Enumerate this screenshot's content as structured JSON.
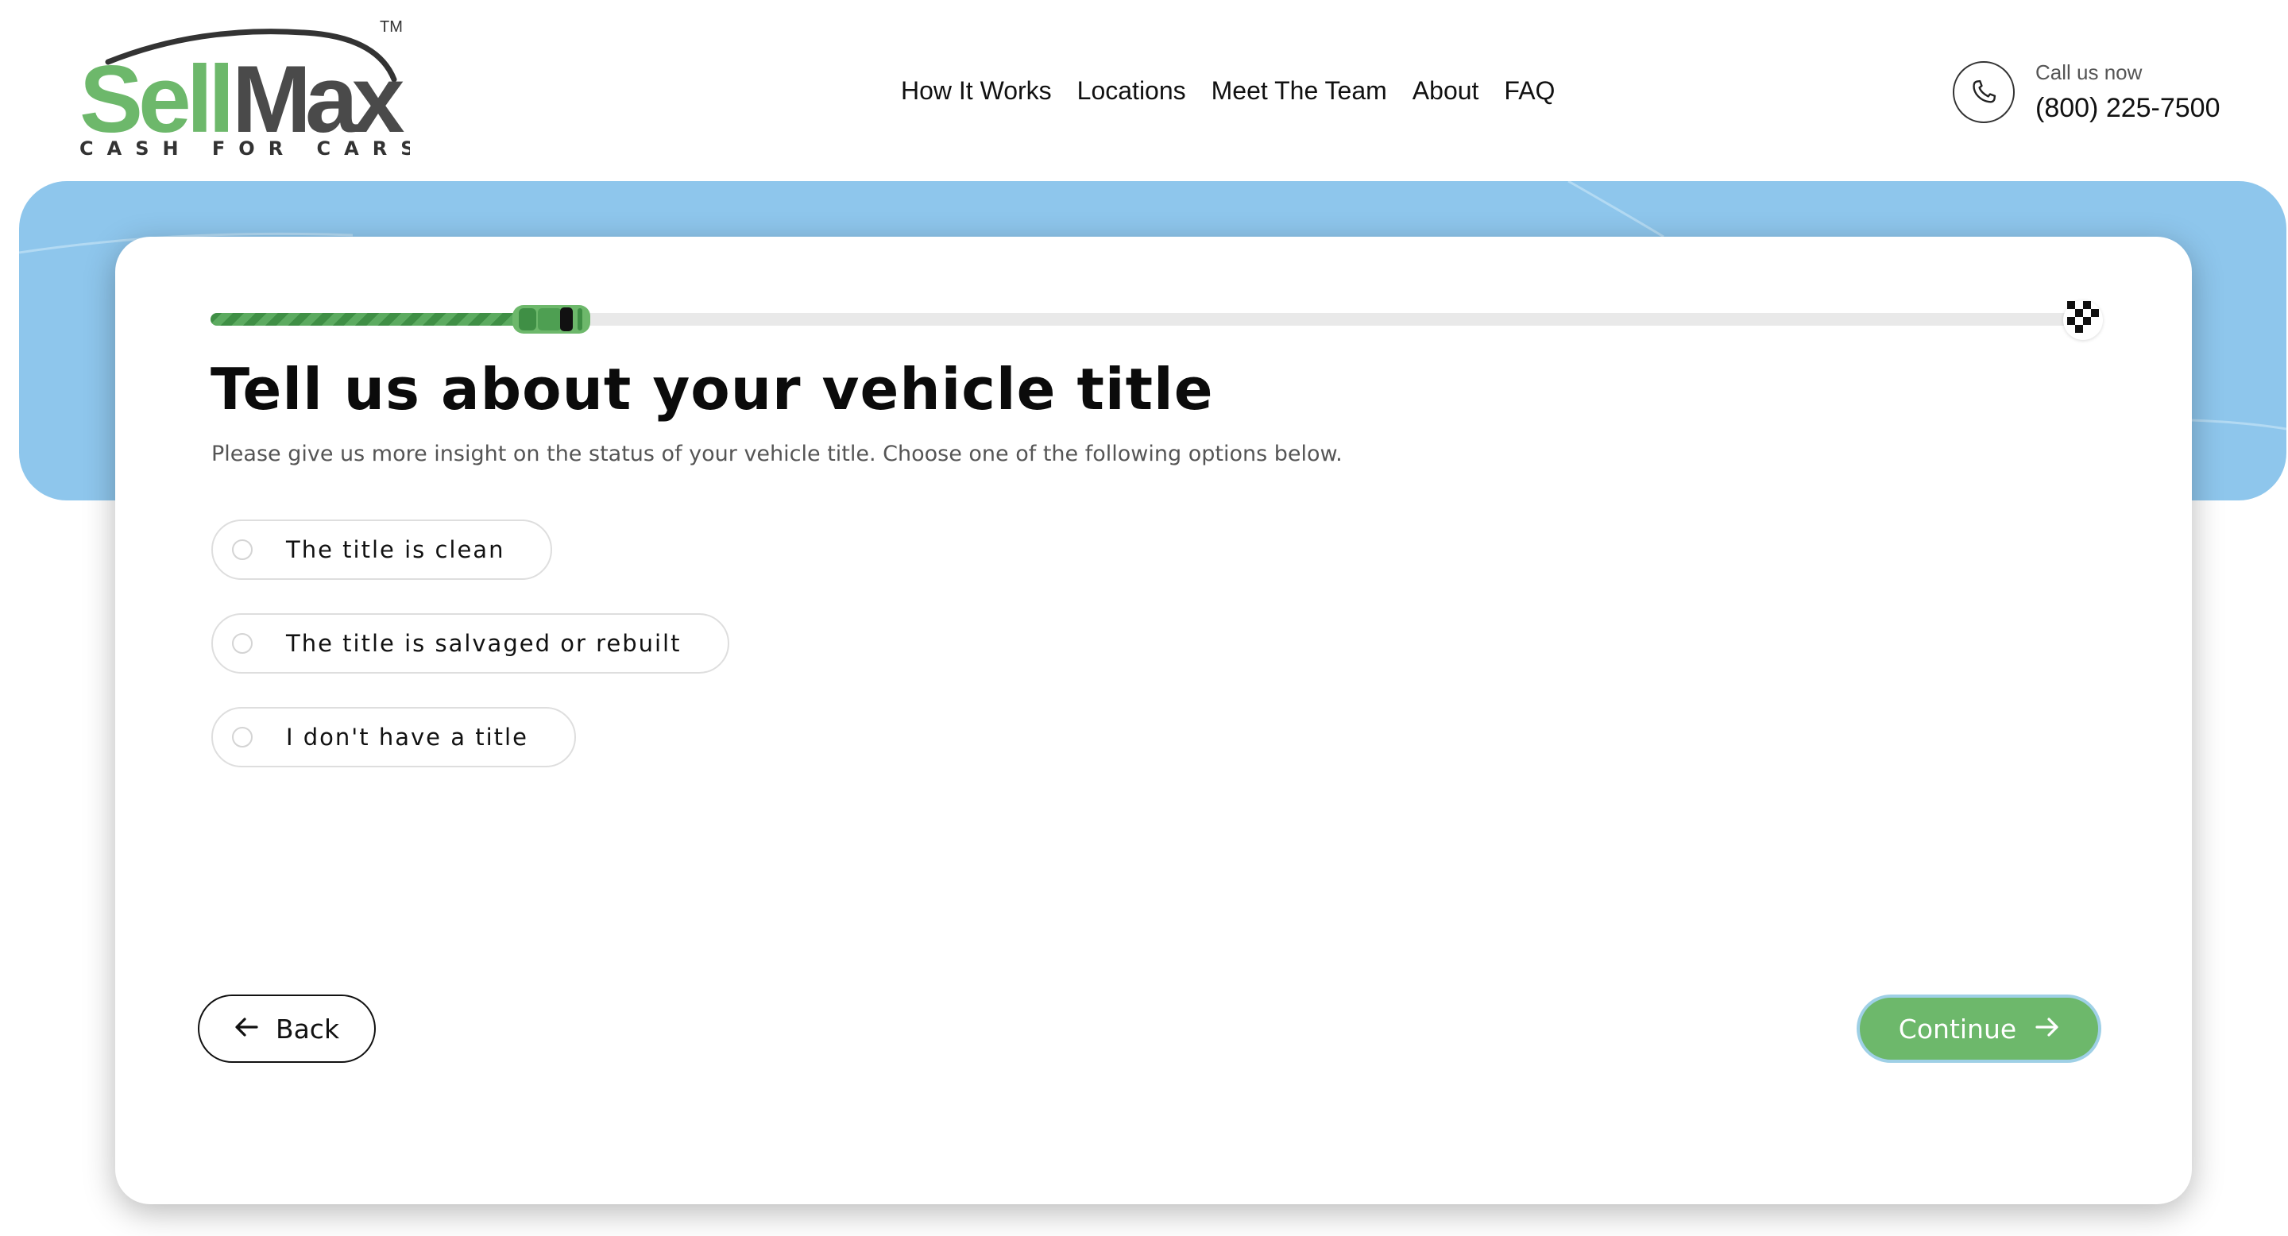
{
  "brand": {
    "logo_word_part1": "Sell",
    "logo_word_part2": "Max",
    "logo_tagline": "CASH FOR CARS",
    "trademark": "TM",
    "green": "#6db86b",
    "dark_gray": "#4a4a4a"
  },
  "nav": {
    "items": [
      "How It Works",
      "Locations",
      "Meet The Team",
      "About",
      "FAQ"
    ]
  },
  "contact": {
    "label": "Call us now",
    "phone": "(800) 225-7500",
    "icon": "phone-icon"
  },
  "colors": {
    "hero_band": "#8ec6ec",
    "accent_green": "#6db86b",
    "continue_outline": "#9fd0e6"
  },
  "progress": {
    "fraction": 0.18,
    "start_icon": "car-icon",
    "end_icon": "checkered-flag-icon"
  },
  "question": {
    "title": "Tell us about your vehicle title",
    "subtitle": "Please give us more insight on the status of your vehicle title. Choose one of the following options below.",
    "options": [
      "The title is clean",
      "The title is salvaged or rebuilt",
      "I don't have a title"
    ],
    "selected": null
  },
  "actions": {
    "back_label": "Back",
    "back_icon": "arrow-left-icon",
    "continue_label": "Continue",
    "continue_icon": "arrow-right-icon"
  }
}
